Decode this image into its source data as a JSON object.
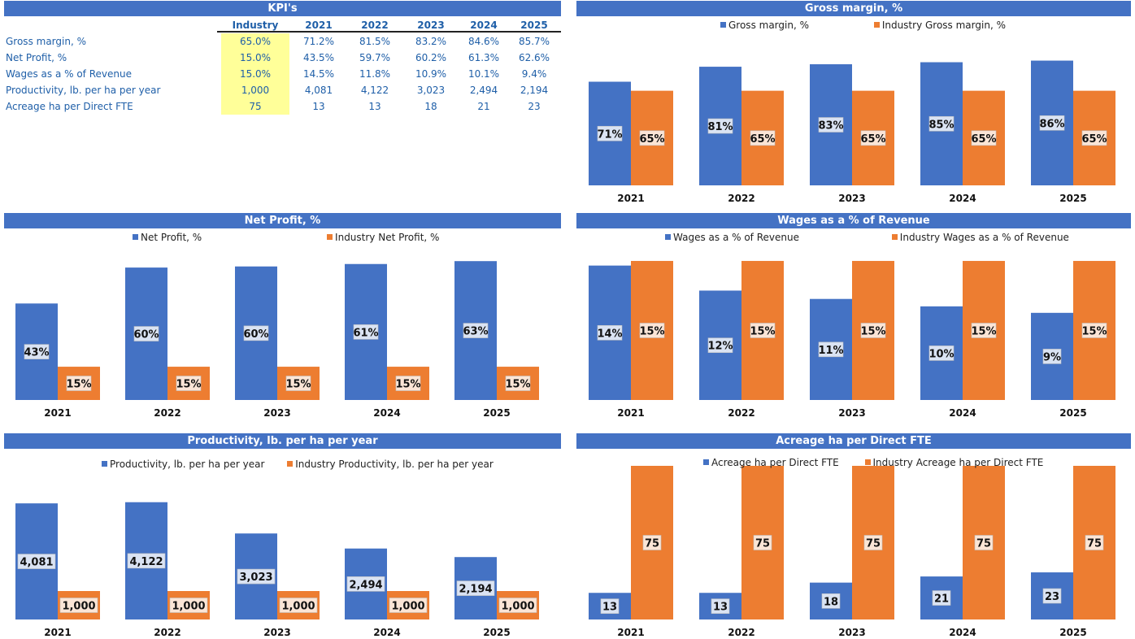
{
  "kpi_table": {
    "title": "KPI's",
    "columns": [
      "Industry",
      "2021",
      "2022",
      "2023",
      "2024",
      "2025"
    ],
    "rows": [
      {
        "label": "Gross margin, %",
        "values": [
          "65.0%",
          "71.2%",
          "81.5%",
          "83.2%",
          "84.6%",
          "85.7%"
        ]
      },
      {
        "label": "Net Profit, %",
        "values": [
          "15.0%",
          "43.5%",
          "59.7%",
          "60.2%",
          "61.3%",
          "62.6%"
        ]
      },
      {
        "label": "Wages as a % of Revenue",
        "values": [
          "15.0%",
          "14.5%",
          "11.8%",
          "10.9%",
          "10.1%",
          "9.4%"
        ]
      },
      {
        "label": "Productivity, lb. per ha per year",
        "values": [
          "1,000",
          "4,081",
          "4,122",
          "3,023",
          "2,494",
          "2,194"
        ]
      },
      {
        "label": "Acreage ha per Direct FTE",
        "values": [
          "75",
          "13",
          "13",
          "18",
          "21",
          "23"
        ]
      }
    ]
  },
  "colors": {
    "company": "#4472C4",
    "industry": "#ED7D31",
    "header": "#4472C4",
    "industry_cell": "#FFFF99"
  },
  "chart_data": [
    {
      "type": "bar",
      "id": "gross",
      "title": "Gross margin, %",
      "categories": [
        "2021",
        "2022",
        "2023",
        "2024",
        "2025"
      ],
      "series": [
        {
          "name": "Gross margin, %",
          "values": [
            71.2,
            81.5,
            83.2,
            84.6,
            85.7
          ],
          "labels": [
            "71%",
            "81%",
            "83%",
            "85%",
            "86%"
          ]
        },
        {
          "name": "Industry Gross margin, %",
          "values": [
            65,
            65,
            65,
            65,
            65
          ],
          "labels": [
            "65%",
            "65%",
            "65%",
            "65%",
            "65%"
          ]
        }
      ],
      "ylim": [
        0,
        105
      ],
      "legend": "top"
    },
    {
      "type": "bar",
      "id": "net",
      "title": "Net Profit, %",
      "categories": [
        "2021",
        "2022",
        "2023",
        "2024",
        "2025"
      ],
      "series": [
        {
          "name": "Net Profit, %",
          "values": [
            43.5,
            59.7,
            60.2,
            61.3,
            62.6
          ],
          "labels": [
            "43%",
            "60%",
            "60%",
            "61%",
            "63%"
          ]
        },
        {
          "name": "Industry Net Profit, %",
          "values": [
            15,
            15,
            15,
            15,
            15
          ],
          "labels": [
            "15%",
            "15%",
            "15%",
            "15%",
            "15%"
          ]
        }
      ],
      "ylim": [
        0,
        70
      ],
      "legend": "top"
    },
    {
      "type": "bar",
      "id": "wages",
      "title": "Wages as a % of Revenue",
      "categories": [
        "2021",
        "2022",
        "2023",
        "2024",
        "2025"
      ],
      "series": [
        {
          "name": "Wages as a % of Revenue",
          "values": [
            14.5,
            11.8,
            10.9,
            10.1,
            9.4
          ],
          "labels": [
            "14%",
            "12%",
            "11%",
            "10%",
            "9%"
          ]
        },
        {
          "name": "Industry Wages as a % of Revenue",
          "values": [
            15,
            15,
            15,
            15,
            15
          ],
          "labels": [
            "15%",
            "15%",
            "15%",
            "15%",
            "15%"
          ]
        }
      ],
      "ylim": [
        0,
        16.75
      ],
      "legend": "top"
    },
    {
      "type": "bar",
      "id": "prod",
      "title": "Productivity, lb. per ha per year",
      "categories": [
        "2021",
        "2022",
        "2023",
        "2024",
        "2025"
      ],
      "series": [
        {
          "name": "Productivity, lb. per ha per year",
          "values": [
            4081,
            4122,
            3023,
            2494,
            2194
          ],
          "labels": [
            "4,081",
            "4,122",
            "3,023",
            "2,494",
            "2,194"
          ]
        },
        {
          "name": "Industry Productivity, lb. per ha per year",
          "values": [
            1000,
            1000,
            1000,
            1000,
            1000
          ],
          "labels": [
            "1,000",
            "1,000",
            "1,000",
            "1,000",
            "1,000"
          ]
        }
      ],
      "ylim": [
        0,
        5200
      ],
      "legend": "top"
    },
    {
      "type": "bar",
      "id": "acre",
      "title": "Acreage ha per Direct FTE",
      "categories": [
        "2021",
        "2022",
        "2023",
        "2024",
        "2025"
      ],
      "series": [
        {
          "name": "Acreage ha per Direct FTE",
          "values": [
            13,
            13,
            18,
            21,
            23
          ],
          "labels": [
            "13",
            "13",
            "18",
            "21",
            "23"
          ]
        },
        {
          "name": "Industry Acreage ha per Direct FTE",
          "values": [
            75,
            75,
            75,
            75,
            75
          ],
          "labels": [
            "75",
            "75",
            "75",
            "75",
            "75"
          ]
        }
      ],
      "ylim": [
        0,
        75
      ],
      "legend": "top"
    }
  ]
}
